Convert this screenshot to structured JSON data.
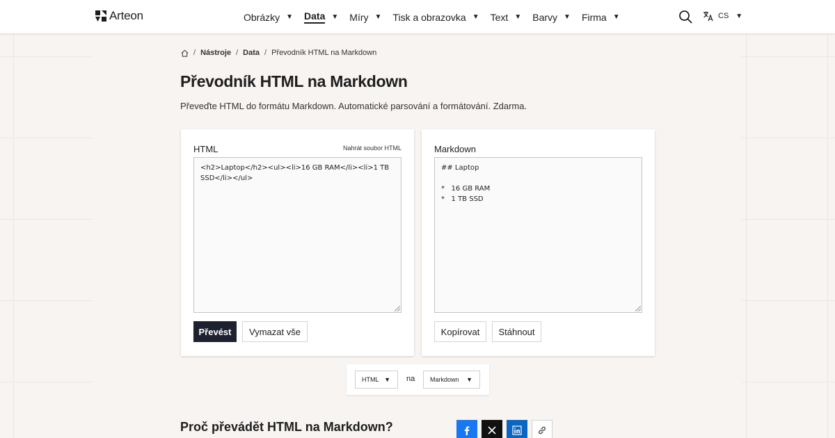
{
  "brand": {
    "name": "Arteon"
  },
  "nav": {
    "items": [
      {
        "label": "Obrázky",
        "active": false
      },
      {
        "label": "Data",
        "active": true
      },
      {
        "label": "Míry",
        "active": false
      },
      {
        "label": "Tisk a obrazovka",
        "active": false
      },
      {
        "label": "Text",
        "active": false
      },
      {
        "label": "Barvy",
        "active": false
      },
      {
        "label": "Firma",
        "active": false
      }
    ],
    "caret": "▼"
  },
  "language": {
    "code": "CS"
  },
  "breadcrumb": {
    "items": [
      "Nástroje",
      "Data",
      "Převodník HTML na Markdown"
    ],
    "sep": "/"
  },
  "page": {
    "title": "Převodník HTML na Markdown",
    "description": "Převeďte HTML do formátu Markdown. Automatické parsování a formátování. Zdarma."
  },
  "input_panel": {
    "label": "HTML",
    "upload_link": "Nahrát soubor HTML",
    "value": "<h2>Laptop</h2><ul><li>16 GB RAM</li><li>1 TB SSD</li></ul>",
    "convert_button": "Převést",
    "clear_button": "Vymazat vše"
  },
  "output_panel": {
    "label": "Markdown",
    "value": "## Laptop\n\n*   16 GB RAM\n*   1 TB SSD",
    "copy_button": "Kopírovat",
    "download_button": "Stáhnout"
  },
  "converter": {
    "from": "HTML",
    "connector": "na",
    "to": "Markdown"
  },
  "section": {
    "title": "Proč převádět HTML na Markdown?"
  },
  "share": {
    "facebook_color": "#1877f2",
    "x_color": "#111111",
    "linkedin_color": "#0a66c2"
  },
  "colors": {
    "accent": "#1e2130",
    "background": "#f7f4f1"
  }
}
